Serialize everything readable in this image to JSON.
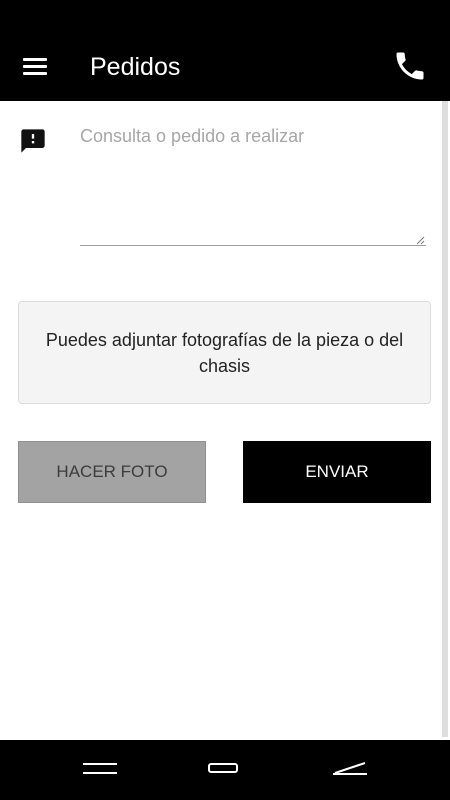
{
  "appbar": {
    "title": "Pedidos",
    "menu_icon": "hamburger-menu-icon",
    "phone_icon": "phone-icon"
  },
  "form": {
    "message_icon": "feedback-message-icon",
    "query_placeholder": "Consulta o pedido a realizar",
    "query_value": "",
    "info_text": "Puedes adjuntar fotografías de la pieza o del chasis",
    "photo_button_label": "HACER FOTO",
    "send_button_label": "ENVIAR"
  },
  "navbar": {
    "back_icon": "nav-back-icon",
    "home_icon": "nav-home-icon",
    "recent_icon": "nav-recent-icon"
  },
  "colors": {
    "appbar": "#000000",
    "photo_button": "#a3a3a3",
    "send_button": "#000000",
    "info_box": "#f4f4f4"
  }
}
